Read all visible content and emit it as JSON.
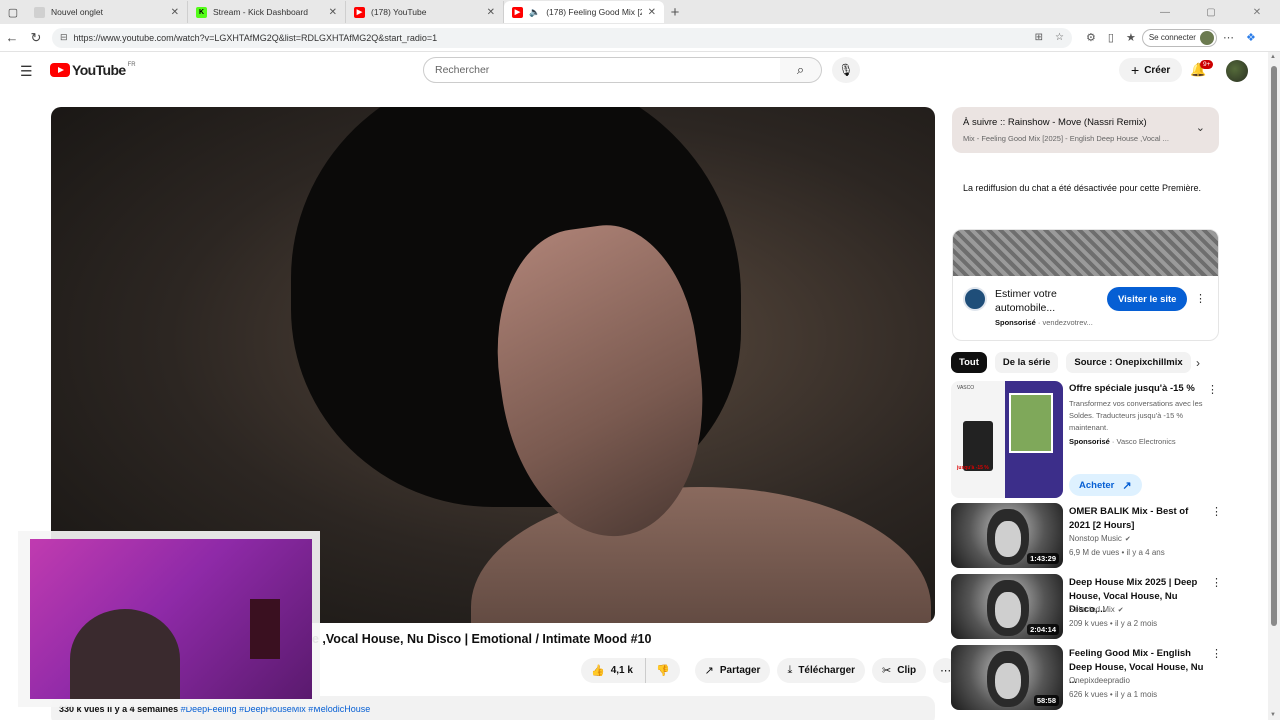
{
  "browser": {
    "tabs": [
      {
        "title": "Nouvel onglet",
        "icon": "page-icon",
        "color": "#9aa0a6"
      },
      {
        "title": "Stream - Kick Dashboard",
        "icon": "kick-icon",
        "color": "#53fc18"
      },
      {
        "title": "(178) YouTube",
        "icon": "youtube-icon",
        "color": "#ff0000"
      },
      {
        "title": "(178) Feeling Good Mix [2025",
        "icon": "youtube-icon",
        "color": "#ff0000"
      }
    ],
    "url": "https://www.youtube.com/watch?v=LGXHTAfMG2Q&list=RDLGXHTAfMG2Q&start_radio=1",
    "connect_label": "Se connecter"
  },
  "header": {
    "logo": "YouTube",
    "country": "FR",
    "search_placeholder": "Rechercher",
    "create_label": "Créer",
    "notif_count": "9+"
  },
  "video": {
    "title": "e ,Vocal House, Nu Disco | Emotional / Intimate Mood #10",
    "likes": "4,1 k",
    "share_label": "Partager",
    "download_label": "Télécharger",
    "clip_label": "Clip",
    "desc_views": "330 k vues",
    "desc_date": "il y a 4 semaines",
    "desc_tags": "#DeepFeeling #DeepHouseMix #MelodicHouse"
  },
  "sidebar": {
    "upnext_title": "À suivre :: Rainshow - Move (Nassri Remix)",
    "upnext_sub": "Mix - Feeling Good Mix [2025] - English Deep House ,Vocal ...",
    "chat_off": "La rediffusion du chat a été désactivée pour cette Première.",
    "ad": {
      "title": "Estimer votre automobile...",
      "sponsored": "Sponsorisé",
      "domain": "vendezvotrev...",
      "button": "Visiter le site"
    },
    "chips": [
      "Tout",
      "De la série",
      "Source : Onepixchillmix"
    ],
    "promo": {
      "title": "Offre spéciale jusqu'à -15 %",
      "desc": "Transformez vos conversations avec les Soldes. Traducteurs jusqu'à -15 % maintenant.",
      "sponsored": "Sponsorisé",
      "advertiser": "Vasco Electronics",
      "button": "Acheter",
      "img_tag": "VASCO",
      "img_pct": "jusqu'à -15 %"
    },
    "recs": [
      {
        "title": "OMER BALIK Mix - Best of 2021 [2 Hours]",
        "channel": "Nonstop Music",
        "verified": true,
        "meta": "6,9 M de vues • il y a 4 ans",
        "duration": "1:43:29"
      },
      {
        "title": "Deep House Mix 2025 | Deep House, Vocal House, Nu Disco,...",
        "channel": "Selected Mix",
        "verified": true,
        "meta": "209 k vues • il y a 2 mois",
        "duration": "2:04:14"
      },
      {
        "title": "Feeling Good Mix - English Deep House, Vocal House, Nu ...",
        "channel": "Onepixdeepradio",
        "verified": false,
        "meta": "626 k vues • il y a 1 mois",
        "duration": "58:58"
      }
    ]
  }
}
